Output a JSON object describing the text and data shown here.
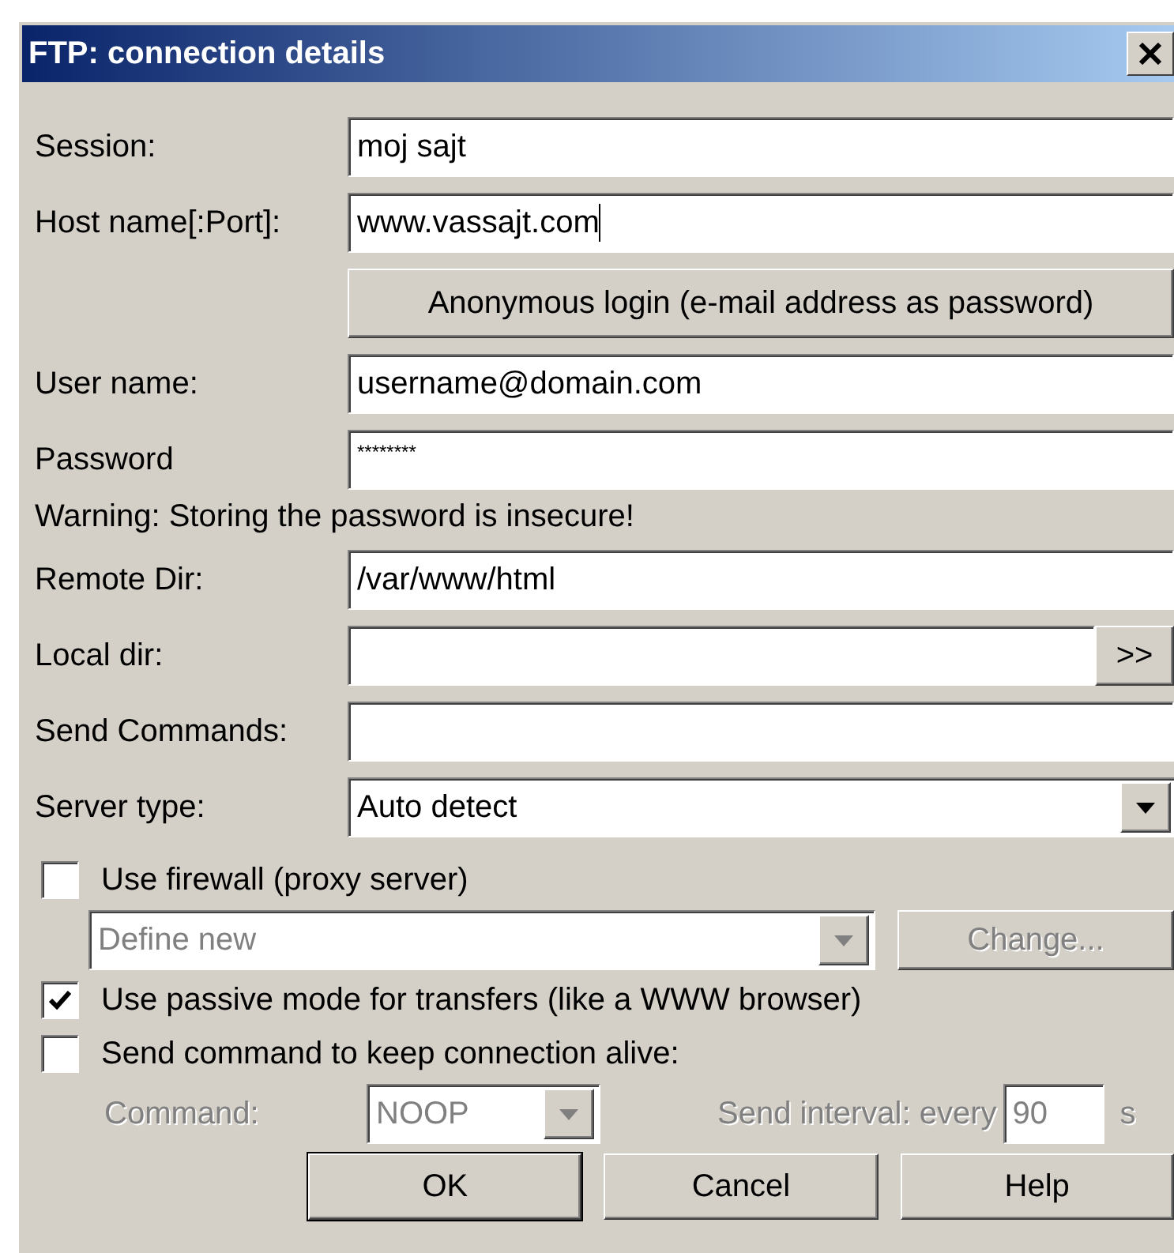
{
  "window": {
    "title": "FTP: connection details"
  },
  "fields": [
    {
      "kind": "text",
      "label": "Session:",
      "value": "moj sajt"
    },
    {
      "kind": "text",
      "label": "Host name[:Port]:",
      "value": "www.vassajt.com",
      "focused": true
    },
    {
      "kind": "button",
      "label": "Anonymous login (e-mail address as password)"
    },
    {
      "kind": "text",
      "label": "User name:",
      "value": "username@domain.com"
    },
    {
      "kind": "password",
      "label": "Password",
      "value": "********"
    },
    {
      "kind": "note",
      "label": "Warning: Storing the password is insecure!"
    },
    {
      "kind": "text",
      "label": "Remote Dir:",
      "value": "/var/www/html"
    },
    {
      "kind": "browse",
      "label": "Local dir:",
      "button": ">>"
    },
    {
      "kind": "text",
      "label": "Send Commands:"
    },
    {
      "kind": "select",
      "label": "Server type:",
      "value": "Auto detect"
    }
  ],
  "firewall": {
    "label": "Use firewall (proxy server)",
    "checked": false,
    "proxy": "Define new",
    "change_button": "Change...",
    "disabled": true
  },
  "passive": {
    "label": "Use passive mode for transfers (like a WWW browser)",
    "checked": true
  },
  "keepalive": {
    "label": "Send command to keep connection alive:",
    "checked": false,
    "disabled": true,
    "command_label": "Command:",
    "command": "NOOP",
    "interval_label": "Send interval: every",
    "interval": "90",
    "unit": "s"
  },
  "buttons": [
    {
      "label": "OK",
      "default": true
    },
    {
      "label": "Cancel",
      "default": false
    },
    {
      "label": "Help",
      "default": false
    }
  ]
}
